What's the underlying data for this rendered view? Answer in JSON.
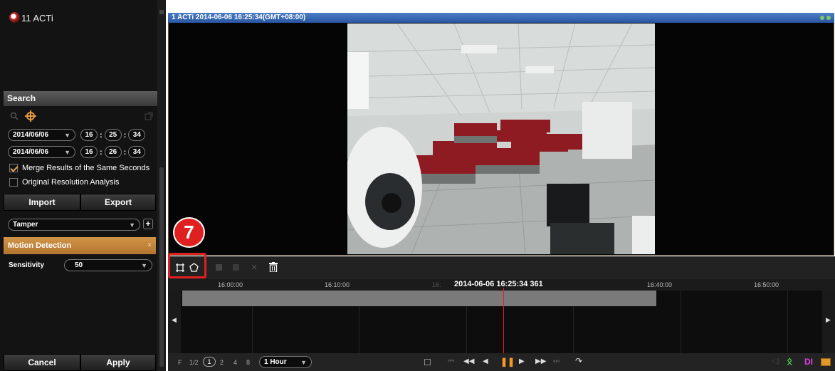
{
  "left_panel": {
    "device_label": "11 ACTi",
    "search_header": "Search",
    "start_date": "2014/06/06",
    "start_time": [
      "16",
      "25",
      "34"
    ],
    "end_date": "2014/06/06",
    "end_time": [
      "16",
      "26",
      "34"
    ],
    "merge_label": "Merge Results of the Same Seconds",
    "original_label": "Original Resolution Analysis",
    "import_label": "Import",
    "export_label": "Export",
    "event_type": "Tamper",
    "motion_label": "Motion Detection",
    "close_mark": "×",
    "sensitivity_label": "Sensitivity",
    "sensitivity_value": "50",
    "cancel_label": "Cancel",
    "apply_label": "Apply"
  },
  "video": {
    "title": "1 ACTi  2014-06-06 16:25:34(GMT+08:00)"
  },
  "callout_number": "7",
  "timeline": {
    "ticks": [
      "16:00:00",
      "16:10:00",
      "16:",
      "16:40:00",
      "16:50:00"
    ],
    "current": "2014-06-06 16:25:34 361"
  },
  "bottom": {
    "speeds": [
      "F",
      "1/2",
      "1",
      "2",
      "4",
      "8"
    ],
    "range": "1 Hour",
    "di_label": "DI"
  },
  "colors": {
    "accent_orange": "#c9893f",
    "callout_red": "#e02020",
    "title_blue": "#2f63b0"
  }
}
